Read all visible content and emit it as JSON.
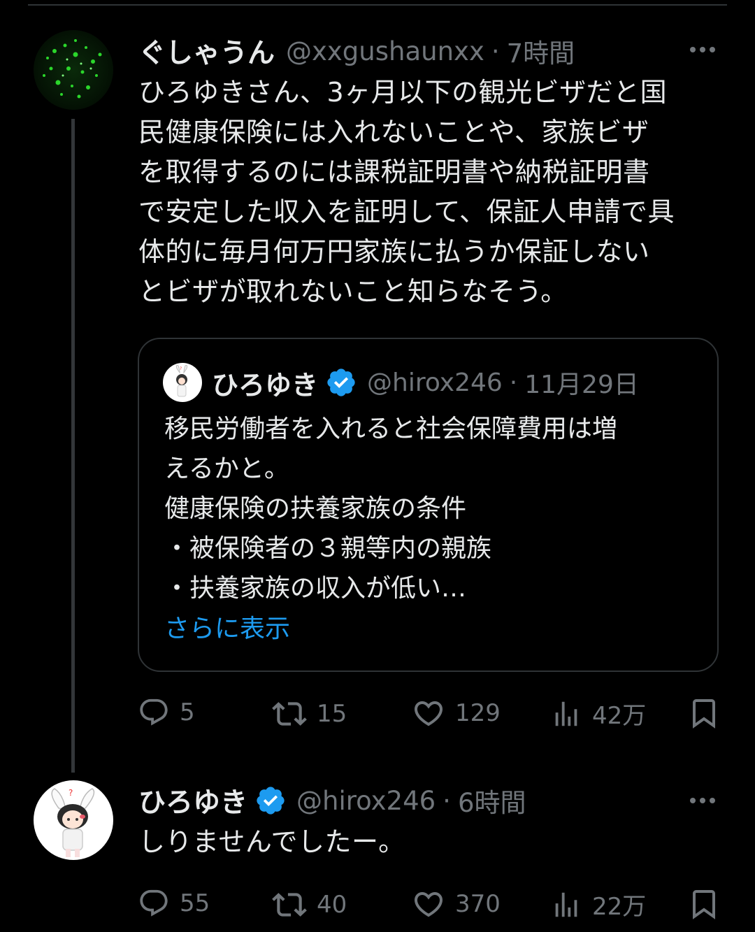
{
  "post1": {
    "name": "ぐしゃうん",
    "handle": "@xxgushaunxx",
    "dot": "·",
    "time": "7時間",
    "text": "ひろゆきさん、3ヶ月以下の観光ビザだと国\n民健康保険には入れないことや、家族ビザ\nを取得するのには課税証明書や納税証明書\nで安定した収入を証明して、保証人申請で具\n体的に毎月何万円家族に払うか保証しない\nとビザが取れないこと知らなそう。",
    "quote": {
      "name": "ひろゆき",
      "handle": "@hirox246",
      "dot": "·",
      "date": "11月29日",
      "text": "移民労働者を入れると社会保障費用は増\nえるかと。\n健康保険の扶養家族の条件\n・被保険者の３親等内の親族\n・扶養家族の収入が低い…",
      "show_more": "さらに表示"
    },
    "stats": {
      "replies": "5",
      "reposts": "15",
      "likes": "129",
      "views": "42万"
    }
  },
  "post2": {
    "name": "ひろゆき",
    "handle": "@hirox246",
    "dot": "·",
    "time": "6時間",
    "text": "しりませんでしたー。",
    "stats": {
      "replies": "55",
      "reposts": "40",
      "likes": "370",
      "views": "22万"
    }
  },
  "colors": {
    "accent": "#1d9bf0",
    "muted": "#71767b",
    "background": "#000000",
    "text": "#e7e9ea"
  }
}
